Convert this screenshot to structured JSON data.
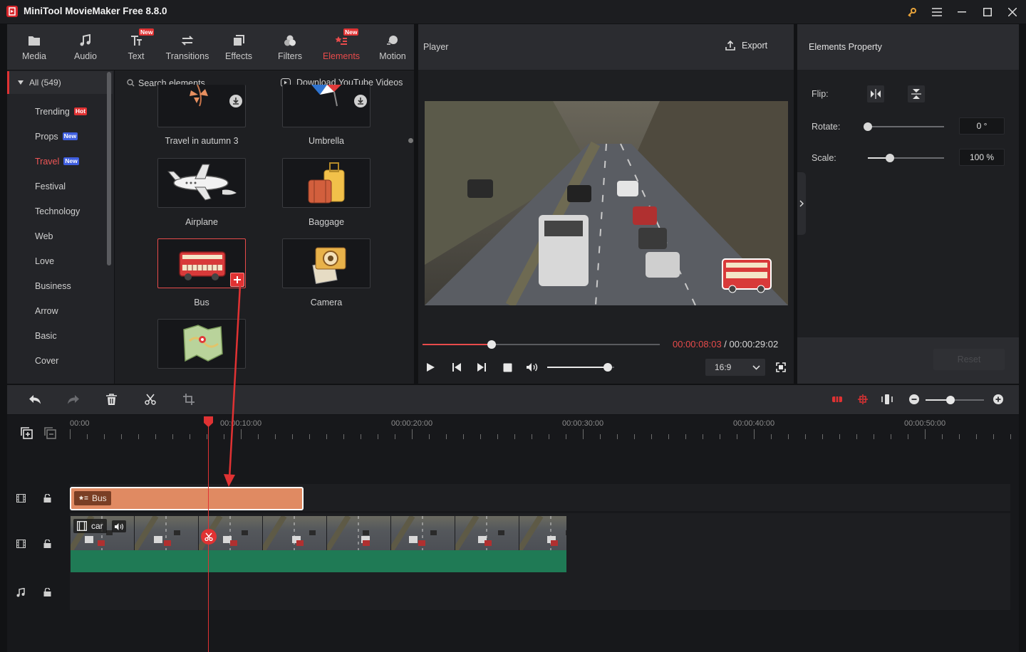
{
  "window": {
    "title": "MiniTool MovieMaker Free 8.8.0"
  },
  "toolbar": {
    "items": [
      {
        "label": "Media",
        "icon": "media-icon"
      },
      {
        "label": "Audio",
        "icon": "music-note-icon"
      },
      {
        "label": "Text",
        "icon": "text-icon",
        "badge": "New"
      },
      {
        "label": "Transitions",
        "icon": "transitions-icon"
      },
      {
        "label": "Effects",
        "icon": "effects-icon"
      },
      {
        "label": "Filters",
        "icon": "filters-icon"
      },
      {
        "label": "Elements",
        "icon": "elements-icon",
        "badge": "New",
        "active": true
      },
      {
        "label": "Motion",
        "icon": "motion-icon"
      }
    ]
  },
  "categories": {
    "all_label": "All (549)",
    "items": [
      {
        "label": "Trending",
        "badge": "Hot"
      },
      {
        "label": "Props",
        "badge": "New"
      },
      {
        "label": "Travel",
        "badge": "New",
        "selected": true
      },
      {
        "label": "Festival"
      },
      {
        "label": "Technology"
      },
      {
        "label": "Web"
      },
      {
        "label": "Love"
      },
      {
        "label": "Business"
      },
      {
        "label": "Arrow"
      },
      {
        "label": "Basic"
      },
      {
        "label": "Cover"
      }
    ]
  },
  "elements": {
    "search_placeholder": "Search elements",
    "download_label": "Download YouTube Videos",
    "items": [
      {
        "label": "Travel in autumn 3"
      },
      {
        "label": "Umbrella"
      },
      {
        "label": "Airplane"
      },
      {
        "label": "Baggage"
      },
      {
        "label": "Bus"
      },
      {
        "label": "Camera"
      }
    ]
  },
  "player": {
    "title": "Player",
    "export_label": "Export",
    "current_time": "00:00:08:03",
    "separator": " / ",
    "total_time": "00:00:29:02",
    "aspect_ratio": "16:9",
    "progress": 0.29,
    "volume": 0.9
  },
  "properties": {
    "title": "Elements Property",
    "flip_label": "Flip:",
    "rotate_label": "Rotate:",
    "rotate_value": "0 °",
    "rotate_level": 0.0,
    "scale_label": "Scale:",
    "scale_value": "100 %",
    "scale_level": 0.29,
    "reset_label": "Reset"
  },
  "timeline": {
    "ruler_labels": [
      "00:00",
      "00:00:10:00",
      "00:00:20:00",
      "00:00:30:00",
      "00:00:40:00",
      "00:00:50:00"
    ],
    "element_clip_label": "Bus",
    "video_clip_label": "car",
    "zoom_level": 0.43
  },
  "colors": {
    "accent": "#e84b4b",
    "element_clip": "#e08a62",
    "audio_strip": "#1f7a55",
    "background": "#111214"
  }
}
